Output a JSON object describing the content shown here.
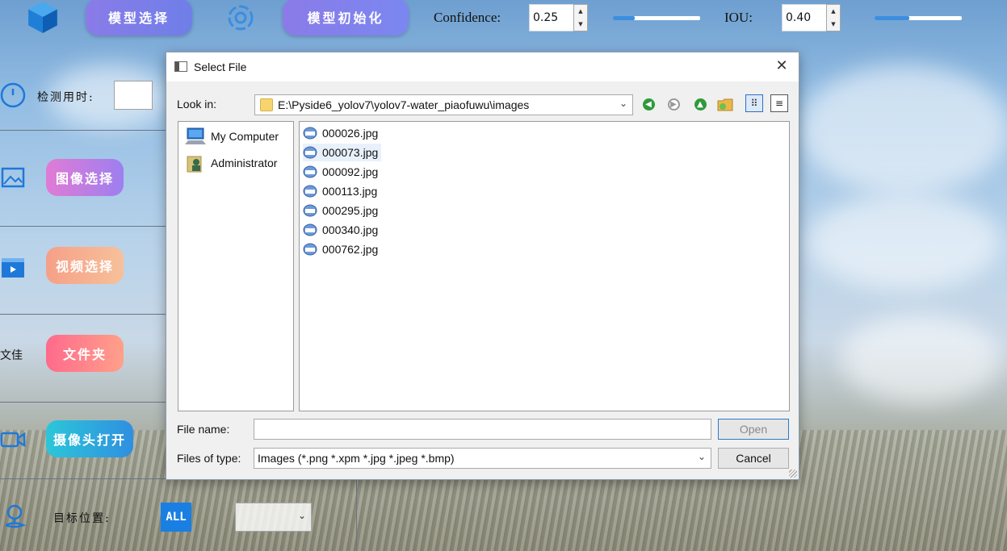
{
  "toolbar": {
    "model_select_label": "模型选择",
    "model_init_label": "模型初始化",
    "confidence_label": "Confidence:",
    "confidence_value": "0.25",
    "confidence_fraction": 0.25,
    "iou_label": "IOU:",
    "iou_value": "0.40",
    "iou_fraction": 0.4
  },
  "sidebar": {
    "detect_time_label": "检测用时:",
    "image_select_label": "图像选择",
    "video_select_label": "视频选择",
    "folder_label": "文件夹",
    "folder_side_text": "文佳",
    "camera_label": "摄像头打开",
    "target_position_label": "目标位置:",
    "all_badge": "ALL"
  },
  "dialog": {
    "title": "Select File",
    "look_in_label": "Look in:",
    "path": "E:\\Pyside6_yolov7\\yolov7-water_piaofuwu\\images",
    "places": [
      {
        "label": "My Computer"
      },
      {
        "label": "Administrator"
      }
    ],
    "files": [
      {
        "name": "000026.jpg",
        "selected": false
      },
      {
        "name": "000073.jpg",
        "selected": true
      },
      {
        "name": "000092.jpg",
        "selected": false
      },
      {
        "name": "000113.jpg",
        "selected": false
      },
      {
        "name": "000295.jpg",
        "selected": false
      },
      {
        "name": "000340.jpg",
        "selected": false
      },
      {
        "name": "000762.jpg",
        "selected": false
      }
    ],
    "file_name_label": "File name:",
    "file_name_value": "",
    "files_of_type_label": "Files of type:",
    "files_of_type_value": "Images (*.png *.xpm *.jpg *.jpeg *.bmp)",
    "open_label": "Open",
    "cancel_label": "Cancel",
    "close_glyph": "✕"
  },
  "colors": {
    "accent": "#3c8ee0",
    "badge": "#1a7fe2"
  }
}
